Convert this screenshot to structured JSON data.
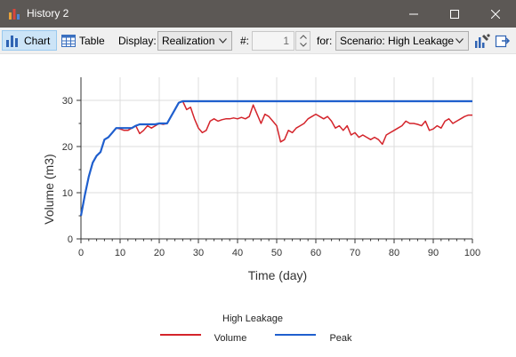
{
  "window": {
    "title": "History 2"
  },
  "toolbar": {
    "chart_label": "Chart",
    "table_label": "Table",
    "display_label": "Display:",
    "display_value": "Realization",
    "number_label": "#:",
    "number_value": "1",
    "for_label": "for:",
    "for_value": "Scenario: High Leakage"
  },
  "colors": {
    "volume": "#d4242b",
    "peak": "#1f5fce",
    "titlebar": "#5c5855"
  },
  "chart_data": {
    "type": "line",
    "xlabel": "Time (day)",
    "ylabel": "Volume (m3)",
    "xlim": [
      0,
      100
    ],
    "ylim": [
      0,
      35
    ],
    "xticks": [
      0,
      10,
      20,
      30,
      40,
      50,
      60,
      70,
      80,
      90,
      100
    ],
    "yticks": [
      0,
      10,
      20,
      30
    ],
    "grid": true,
    "legend_title": "High Leakage",
    "legend_position": "bottom",
    "series": [
      {
        "name": "Volume",
        "x": [
          0,
          1,
          2,
          3,
          4,
          5,
          6,
          7,
          8,
          9,
          10,
          11,
          12,
          13,
          14,
          15,
          16,
          17,
          18,
          19,
          20,
          21,
          22,
          23,
          24,
          25,
          26,
          27,
          28,
          29,
          30,
          31,
          32,
          33,
          34,
          35,
          36,
          37,
          38,
          39,
          40,
          41,
          42,
          43,
          44,
          45,
          46,
          47,
          48,
          49,
          50,
          51,
          52,
          53,
          54,
          55,
          56,
          57,
          58,
          59,
          60,
          61,
          62,
          63,
          64,
          65,
          66,
          67,
          68,
          69,
          70,
          71,
          72,
          73,
          74,
          75,
          76,
          77,
          78,
          79,
          80,
          81,
          82,
          83,
          84,
          85,
          86,
          87,
          88,
          89,
          90,
          91,
          92,
          93,
          94,
          95,
          96,
          97,
          98,
          99,
          100
        ],
        "values": [
          5.0,
          9.5,
          13.5,
          16.5,
          18.0,
          18.8,
          21.5,
          22.0,
          23.0,
          24.0,
          23.8,
          23.5,
          23.5,
          24.0,
          24.5,
          22.8,
          23.5,
          24.5,
          24.0,
          24.5,
          25.0,
          24.8,
          25.0,
          26.5,
          28.0,
          29.5,
          29.8,
          28.0,
          28.5,
          26.0,
          24.0,
          23.0,
          23.5,
          25.5,
          26.0,
          25.5,
          25.8,
          26.0,
          26.0,
          26.2,
          26.0,
          26.3,
          26.0,
          26.5,
          29.0,
          27.0,
          25.0,
          27.0,
          26.5,
          25.5,
          24.5,
          21.0,
          21.5,
          23.5,
          23.0,
          24.0,
          24.5,
          25.0,
          26.0,
          26.5,
          27.0,
          26.5,
          26.0,
          26.5,
          25.5,
          24.0,
          24.5,
          23.5,
          24.5,
          22.5,
          23.0,
          22.0,
          22.5,
          22.0,
          21.5,
          22.0,
          21.5,
          20.5,
          22.5,
          23.0,
          23.5,
          24.0,
          24.5,
          25.5,
          25.0,
          25.0,
          24.8,
          24.5,
          25.5,
          23.5,
          23.8,
          24.5,
          24.0,
          25.5,
          26.0,
          25.0,
          25.5,
          26.0,
          26.5,
          26.8,
          26.8
        ]
      },
      {
        "name": "Peak",
        "x": [
          0,
          1,
          2,
          3,
          4,
          5,
          6,
          7,
          8,
          9,
          10,
          11,
          12,
          13,
          14,
          15,
          16,
          17,
          18,
          19,
          20,
          21,
          22,
          23,
          24,
          25,
          26,
          27,
          28,
          29,
          30,
          100
        ],
        "values": [
          5.0,
          9.5,
          13.5,
          16.5,
          18.0,
          18.8,
          21.5,
          22.0,
          23.0,
          24.0,
          24.0,
          24.0,
          24.0,
          24.0,
          24.5,
          24.8,
          24.8,
          24.8,
          24.8,
          24.8,
          25.0,
          25.0,
          25.0,
          26.5,
          28.0,
          29.5,
          29.8,
          29.8,
          29.8,
          29.8,
          29.8,
          29.8
        ]
      }
    ]
  }
}
